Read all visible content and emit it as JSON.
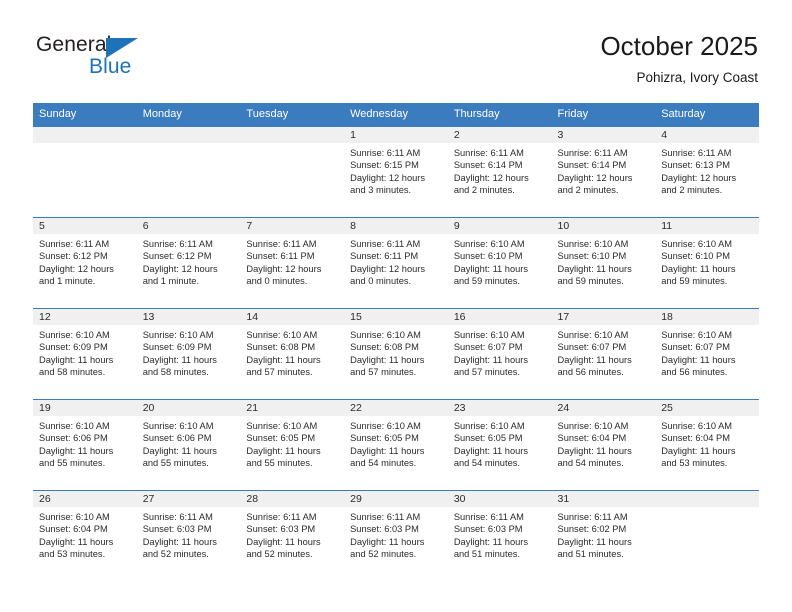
{
  "brand": {
    "name_part1": "General",
    "name_part2": "Blue",
    "flag_icon": "triangle-flag-icon",
    "accent_color": "#1d72b8"
  },
  "header": {
    "title": "October 2025",
    "subtitle": "Pohizra, Ivory Coast"
  },
  "theme": {
    "header_row_bg": "#3a7cbe",
    "day_band_bg": "#f0f0f0",
    "row_border": "#3a7cbe",
    "text_color": "#2b2b2b"
  },
  "weekday_headers": [
    "Sunday",
    "Monday",
    "Tuesday",
    "Wednesday",
    "Thursday",
    "Friday",
    "Saturday"
  ],
  "weeks": [
    [
      {
        "day": "",
        "empty": true,
        "sunrise": "",
        "sunset": "",
        "daylight_line1": "",
        "daylight_line2": ""
      },
      {
        "day": "",
        "empty": true,
        "sunrise": "",
        "sunset": "",
        "daylight_line1": "",
        "daylight_line2": ""
      },
      {
        "day": "",
        "empty": true,
        "sunrise": "",
        "sunset": "",
        "daylight_line1": "",
        "daylight_line2": ""
      },
      {
        "day": "1",
        "empty": false,
        "sunrise": "Sunrise: 6:11 AM",
        "sunset": "Sunset: 6:15 PM",
        "daylight_line1": "Daylight: 12 hours",
        "daylight_line2": "and 3 minutes."
      },
      {
        "day": "2",
        "empty": false,
        "sunrise": "Sunrise: 6:11 AM",
        "sunset": "Sunset: 6:14 PM",
        "daylight_line1": "Daylight: 12 hours",
        "daylight_line2": "and 2 minutes."
      },
      {
        "day": "3",
        "empty": false,
        "sunrise": "Sunrise: 6:11 AM",
        "sunset": "Sunset: 6:14 PM",
        "daylight_line1": "Daylight: 12 hours",
        "daylight_line2": "and 2 minutes."
      },
      {
        "day": "4",
        "empty": false,
        "sunrise": "Sunrise: 6:11 AM",
        "sunset": "Sunset: 6:13 PM",
        "daylight_line1": "Daylight: 12 hours",
        "daylight_line2": "and 2 minutes."
      }
    ],
    [
      {
        "day": "5",
        "empty": false,
        "sunrise": "Sunrise: 6:11 AM",
        "sunset": "Sunset: 6:12 PM",
        "daylight_line1": "Daylight: 12 hours",
        "daylight_line2": "and 1 minute."
      },
      {
        "day": "6",
        "empty": false,
        "sunrise": "Sunrise: 6:11 AM",
        "sunset": "Sunset: 6:12 PM",
        "daylight_line1": "Daylight: 12 hours",
        "daylight_line2": "and 1 minute."
      },
      {
        "day": "7",
        "empty": false,
        "sunrise": "Sunrise: 6:11 AM",
        "sunset": "Sunset: 6:11 PM",
        "daylight_line1": "Daylight: 12 hours",
        "daylight_line2": "and 0 minutes."
      },
      {
        "day": "8",
        "empty": false,
        "sunrise": "Sunrise: 6:11 AM",
        "sunset": "Sunset: 6:11 PM",
        "daylight_line1": "Daylight: 12 hours",
        "daylight_line2": "and 0 minutes."
      },
      {
        "day": "9",
        "empty": false,
        "sunrise": "Sunrise: 6:10 AM",
        "sunset": "Sunset: 6:10 PM",
        "daylight_line1": "Daylight: 11 hours",
        "daylight_line2": "and 59 minutes."
      },
      {
        "day": "10",
        "empty": false,
        "sunrise": "Sunrise: 6:10 AM",
        "sunset": "Sunset: 6:10 PM",
        "daylight_line1": "Daylight: 11 hours",
        "daylight_line2": "and 59 minutes."
      },
      {
        "day": "11",
        "empty": false,
        "sunrise": "Sunrise: 6:10 AM",
        "sunset": "Sunset: 6:10 PM",
        "daylight_line1": "Daylight: 11 hours",
        "daylight_line2": "and 59 minutes."
      }
    ],
    [
      {
        "day": "12",
        "empty": false,
        "sunrise": "Sunrise: 6:10 AM",
        "sunset": "Sunset: 6:09 PM",
        "daylight_line1": "Daylight: 11 hours",
        "daylight_line2": "and 58 minutes."
      },
      {
        "day": "13",
        "empty": false,
        "sunrise": "Sunrise: 6:10 AM",
        "sunset": "Sunset: 6:09 PM",
        "daylight_line1": "Daylight: 11 hours",
        "daylight_line2": "and 58 minutes."
      },
      {
        "day": "14",
        "empty": false,
        "sunrise": "Sunrise: 6:10 AM",
        "sunset": "Sunset: 6:08 PM",
        "daylight_line1": "Daylight: 11 hours",
        "daylight_line2": "and 57 minutes."
      },
      {
        "day": "15",
        "empty": false,
        "sunrise": "Sunrise: 6:10 AM",
        "sunset": "Sunset: 6:08 PM",
        "daylight_line1": "Daylight: 11 hours",
        "daylight_line2": "and 57 minutes."
      },
      {
        "day": "16",
        "empty": false,
        "sunrise": "Sunrise: 6:10 AM",
        "sunset": "Sunset: 6:07 PM",
        "daylight_line1": "Daylight: 11 hours",
        "daylight_line2": "and 57 minutes."
      },
      {
        "day": "17",
        "empty": false,
        "sunrise": "Sunrise: 6:10 AM",
        "sunset": "Sunset: 6:07 PM",
        "daylight_line1": "Daylight: 11 hours",
        "daylight_line2": "and 56 minutes."
      },
      {
        "day": "18",
        "empty": false,
        "sunrise": "Sunrise: 6:10 AM",
        "sunset": "Sunset: 6:07 PM",
        "daylight_line1": "Daylight: 11 hours",
        "daylight_line2": "and 56 minutes."
      }
    ],
    [
      {
        "day": "19",
        "empty": false,
        "sunrise": "Sunrise: 6:10 AM",
        "sunset": "Sunset: 6:06 PM",
        "daylight_line1": "Daylight: 11 hours",
        "daylight_line2": "and 55 minutes."
      },
      {
        "day": "20",
        "empty": false,
        "sunrise": "Sunrise: 6:10 AM",
        "sunset": "Sunset: 6:06 PM",
        "daylight_line1": "Daylight: 11 hours",
        "daylight_line2": "and 55 minutes."
      },
      {
        "day": "21",
        "empty": false,
        "sunrise": "Sunrise: 6:10 AM",
        "sunset": "Sunset: 6:05 PM",
        "daylight_line1": "Daylight: 11 hours",
        "daylight_line2": "and 55 minutes."
      },
      {
        "day": "22",
        "empty": false,
        "sunrise": "Sunrise: 6:10 AM",
        "sunset": "Sunset: 6:05 PM",
        "daylight_line1": "Daylight: 11 hours",
        "daylight_line2": "and 54 minutes."
      },
      {
        "day": "23",
        "empty": false,
        "sunrise": "Sunrise: 6:10 AM",
        "sunset": "Sunset: 6:05 PM",
        "daylight_line1": "Daylight: 11 hours",
        "daylight_line2": "and 54 minutes."
      },
      {
        "day": "24",
        "empty": false,
        "sunrise": "Sunrise: 6:10 AM",
        "sunset": "Sunset: 6:04 PM",
        "daylight_line1": "Daylight: 11 hours",
        "daylight_line2": "and 54 minutes."
      },
      {
        "day": "25",
        "empty": false,
        "sunrise": "Sunrise: 6:10 AM",
        "sunset": "Sunset: 6:04 PM",
        "daylight_line1": "Daylight: 11 hours",
        "daylight_line2": "and 53 minutes."
      }
    ],
    [
      {
        "day": "26",
        "empty": false,
        "sunrise": "Sunrise: 6:10 AM",
        "sunset": "Sunset: 6:04 PM",
        "daylight_line1": "Daylight: 11 hours",
        "daylight_line2": "and 53 minutes."
      },
      {
        "day": "27",
        "empty": false,
        "sunrise": "Sunrise: 6:11 AM",
        "sunset": "Sunset: 6:03 PM",
        "daylight_line1": "Daylight: 11 hours",
        "daylight_line2": "and 52 minutes."
      },
      {
        "day": "28",
        "empty": false,
        "sunrise": "Sunrise: 6:11 AM",
        "sunset": "Sunset: 6:03 PM",
        "daylight_line1": "Daylight: 11 hours",
        "daylight_line2": "and 52 minutes."
      },
      {
        "day": "29",
        "empty": false,
        "sunrise": "Sunrise: 6:11 AM",
        "sunset": "Sunset: 6:03 PM",
        "daylight_line1": "Daylight: 11 hours",
        "daylight_line2": "and 52 minutes."
      },
      {
        "day": "30",
        "empty": false,
        "sunrise": "Sunrise: 6:11 AM",
        "sunset": "Sunset: 6:03 PM",
        "daylight_line1": "Daylight: 11 hours",
        "daylight_line2": "and 51 minutes."
      },
      {
        "day": "31",
        "empty": false,
        "sunrise": "Sunrise: 6:11 AM",
        "sunset": "Sunset: 6:02 PM",
        "daylight_line1": "Daylight: 11 hours",
        "daylight_line2": "and 51 minutes."
      },
      {
        "day": "",
        "empty": true,
        "sunrise": "",
        "sunset": "",
        "daylight_line1": "",
        "daylight_line2": ""
      }
    ]
  ]
}
